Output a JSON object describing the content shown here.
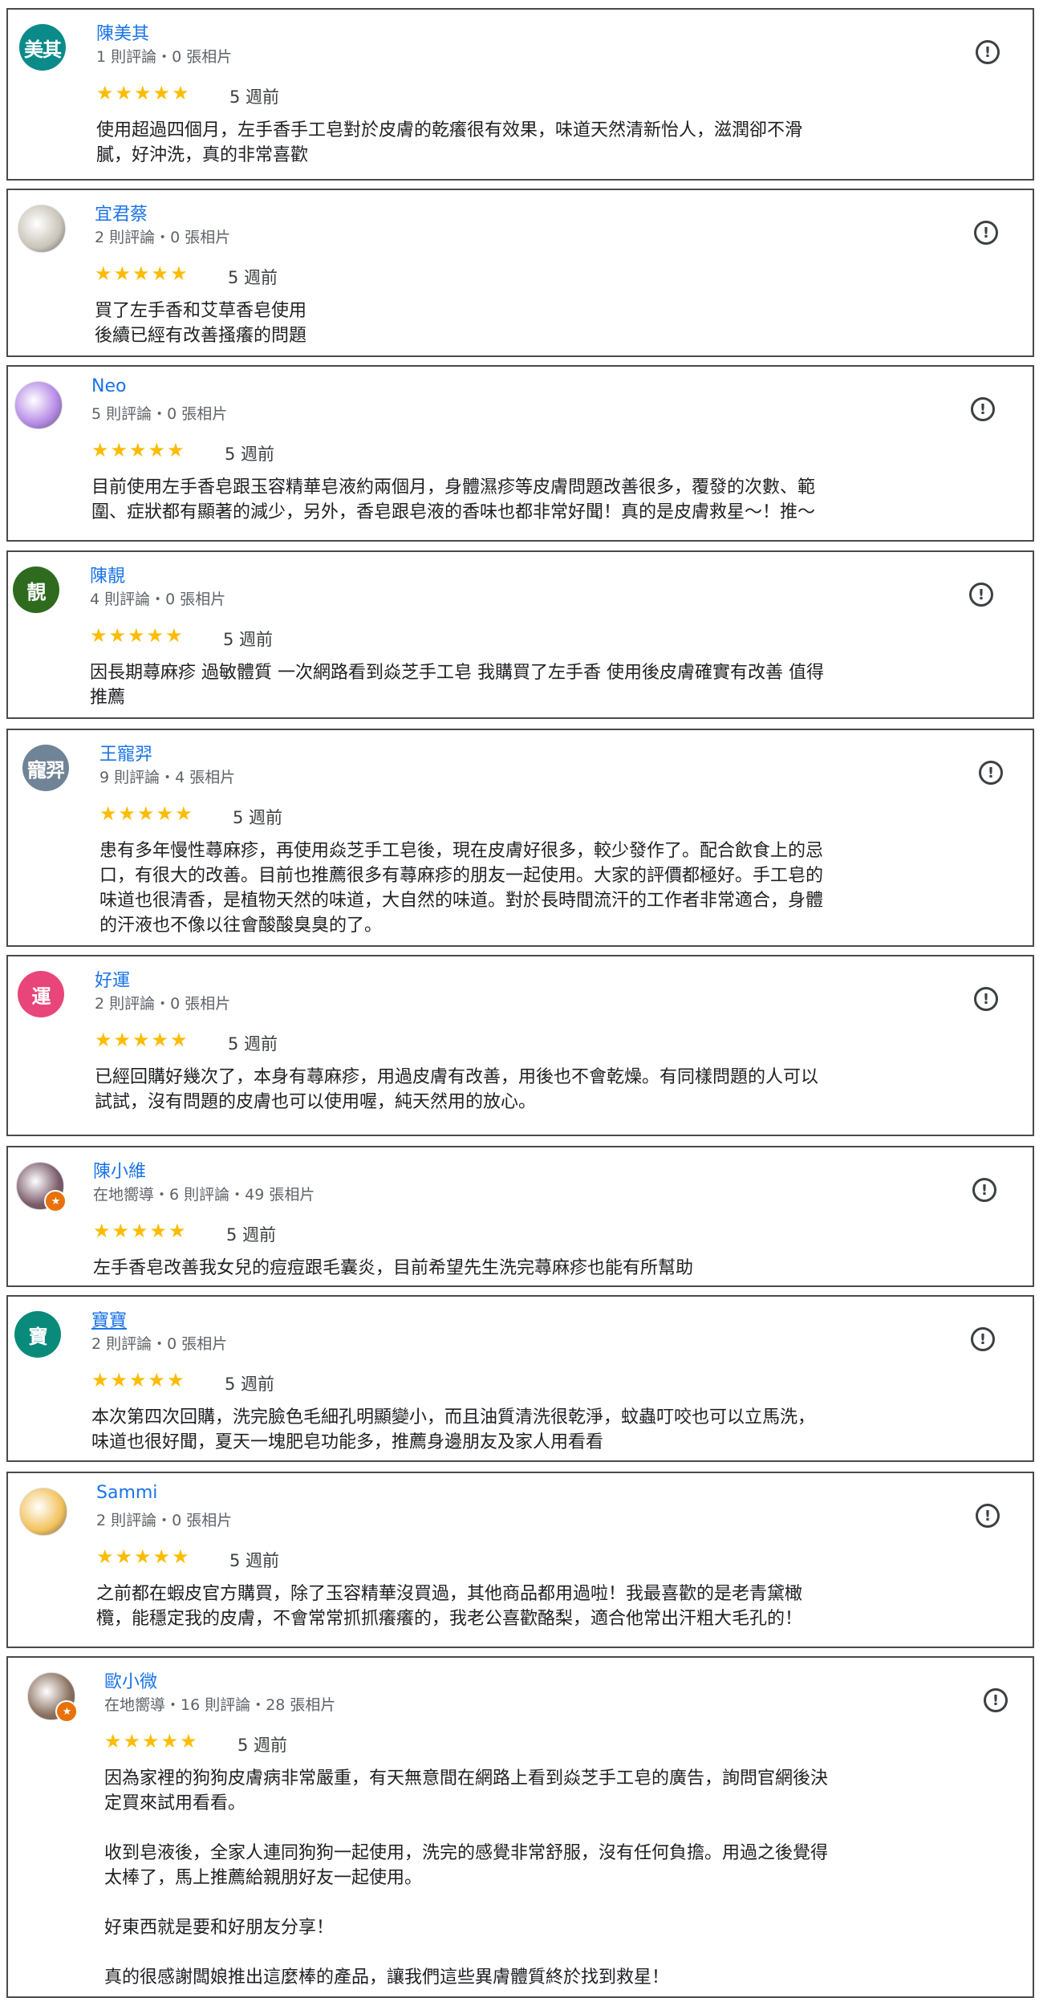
{
  "reviews": [
    {
      "name": "陳美其",
      "avatar": {
        "type": "initial",
        "text": "美其",
        "color": "#0b8a8a"
      },
      "meta": "1 則評論・0 張相片",
      "rating": 5,
      "stars": "★★★★★",
      "time": "5 週前",
      "text": "使用超過四個月，左手香手工皂對於皮膚的乾癢很有效果，味道天然清新怡人，滋潤卻不滑\n膩，好沖洗，真的非常喜歡"
    },
    {
      "name": "宜君蔡",
      "avatar": {
        "type": "photo",
        "color": "#c9c4b8"
      },
      "meta": "2 則評論・0 張相片",
      "rating": 5,
      "stars": "★★★★★",
      "time": "5 週前",
      "text": "買了左手香和艾草香皂使用\n後續已經有改善搔癢的問題"
    },
    {
      "name": "Neo",
      "avatar": {
        "type": "photo",
        "color": "#b488e6"
      },
      "meta": "5 則評論・0 張相片",
      "rating": 5,
      "stars": "★★★★★",
      "time": "5 週前",
      "text": "目前使用左手香皂跟玉容精華皂液約兩個月，身體濕疹等皮膚問題改善很多，覆發的次數、範\n圍、症狀都有顯著的減少，另外，香皂跟皂液的香味也都非常好聞！真的是皮膚救星～！推～"
    },
    {
      "name": "陳靚",
      "avatar": {
        "type": "initial",
        "text": "靚",
        "color": "#2e6b1e"
      },
      "meta": "4 則評論・0 張相片",
      "rating": 5,
      "stars": "★★★★★",
      "time": "5 週前",
      "text": "因長期蕁麻疹 過敏體質 一次網路看到焱芝手工皂 我購買了左手香 使用後皮膚確實有改善 值得\n推薦"
    },
    {
      "name": "王寵羿",
      "avatar": {
        "type": "initial",
        "text": "寵羿",
        "color": "#6f8496"
      },
      "meta": "9 則評論・4 張相片",
      "rating": 5,
      "stars": "★★★★★",
      "time": "5 週前",
      "text": "患有多年慢性蕁麻疹，再使用焱芝手工皂後，現在皮膚好很多，較少發作了。配合飲食上的忌\n口，有很大的改善。目前也推薦很多有蕁麻疹的朋友一起使用。大家的評價都極好。手工皂的\n味道也很清香，是植物天然的味道，大自然的味道。對於長時間流汗的工作者非常適合，身體\n的汗液也不像以往會酸酸臭臭的了。"
    },
    {
      "name": "好運",
      "avatar": {
        "type": "initial",
        "text": "運",
        "color": "#e8457a"
      },
      "meta": "2 則評論・0 張相片",
      "rating": 5,
      "stars": "★★★★★",
      "time": "5 週前",
      "text": "已經回購好幾次了，本身有蕁麻疹，用過皮膚有改善，用後也不會乾燥。有同樣問題的人可以\n試試，沒有問題的皮膚也可以使用喔，純天然用的放心。"
    },
    {
      "name": "陳小維",
      "avatar": {
        "type": "photo",
        "color": "#7a5a6a",
        "guide": true
      },
      "meta": "在地嚮導・6 則評論・49 張相片",
      "rating": 5,
      "stars": "★★★★★",
      "time": "5 週前",
      "text": "左手香皂改善我女兒的痘痘跟毛囊炎，目前希望先生洗完蕁麻疹也能有所幫助"
    },
    {
      "name": "寶寶",
      "avatar": {
        "type": "initial",
        "text": "寶",
        "color": "#0a8a7a"
      },
      "meta": "2 則評論・0 張相片",
      "rating": 5,
      "stars": "★★★★★",
      "time": "5 週前",
      "text": "本次第四次回購，洗完臉色毛細孔明顯變小，而且油質清洗很乾淨，蚊蟲叮咬也可以立馬洗，\n味道也很好聞，夏天一塊肥皂功能多，推薦身邊朋友及家人用看看",
      "underline": true
    },
    {
      "name": "Sammi",
      "avatar": {
        "type": "photo",
        "color": "#f2c15a"
      },
      "meta": "2 則評論・0 張相片",
      "rating": 5,
      "stars": "★★★★★",
      "time": "5 週前",
      "text": "之前都在蝦皮官方購買，除了玉容精華沒買過，其他商品都用過啦！我最喜歡的是老青黛橄\n欖，能穩定我的皮膚，不會常常抓抓癢癢的，我老公喜歡酪梨，適合他常出汗粗大毛孔的！"
    },
    {
      "name": "歐小微",
      "avatar": {
        "type": "photo",
        "color": "#8a7060",
        "guide": true
      },
      "meta": "在地嚮導・16 則評論・28 張相片",
      "rating": 5,
      "stars": "★★★★★",
      "time": "5 週前",
      "text": "因為家裡的狗狗皮膚病非常嚴重，有天無意間在網路上看到焱芝手工皂的廣告，詢問官網後決\n定買來試用看看。\n\n收到皂液後，全家人連同狗狗一起使用，洗完的感覺非常舒服，沒有任何負擔。用過之後覺得\n太棒了，馬上推薦給親朋好友一起使用。\n\n好東西就是要和好朋友分享！\n\n真的很感謝闆娘推出這麼棒的產品，讓我們這些異膚體質終於找到救星！"
    }
  ],
  "icons": {
    "report": "report-flag-icon",
    "guide": "local-guide-badge-icon"
  }
}
